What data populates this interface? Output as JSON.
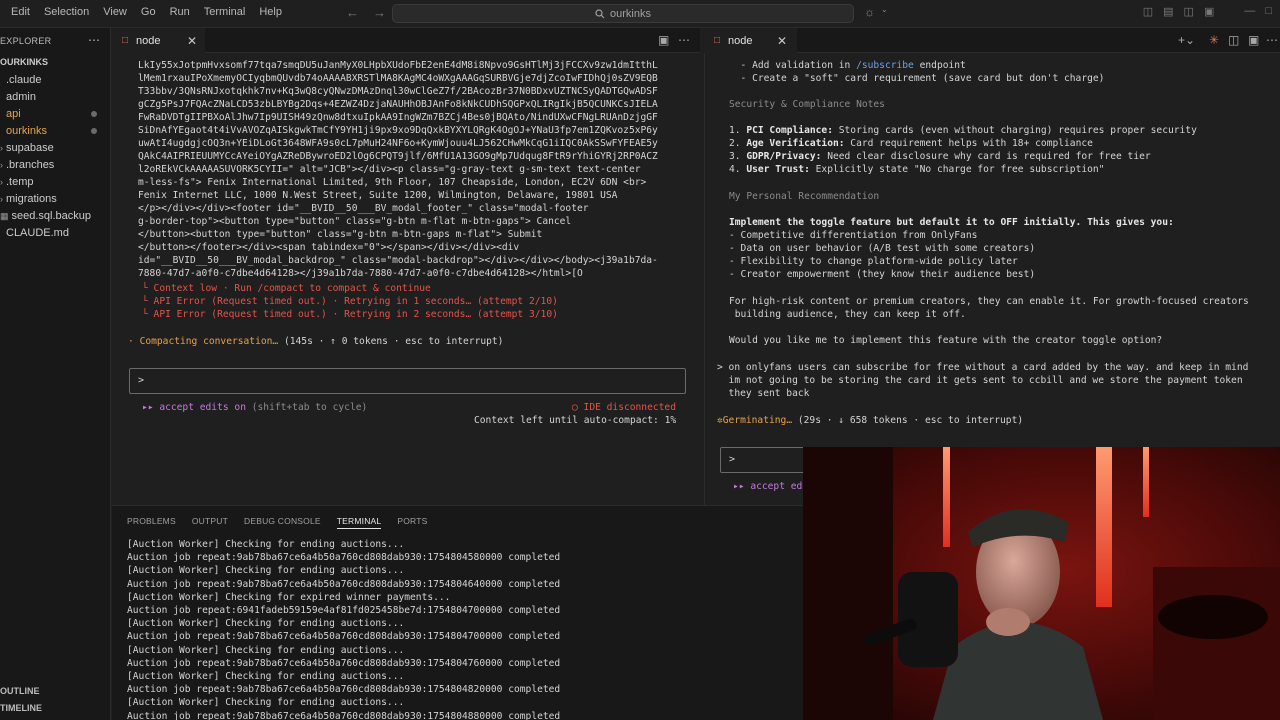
{
  "titlebar": {
    "menus": [
      "Edit",
      "Selection",
      "View",
      "Go",
      "Run",
      "Terminal",
      "Help"
    ],
    "search_text": "ourkinks"
  },
  "explorer": {
    "header": "EXPLORER",
    "project": "OURKINKS",
    "items": [
      {
        "label": ".claude",
        "caret": false
      },
      {
        "label": "admin",
        "caret": false
      },
      {
        "label": "api",
        "caret": false
      },
      {
        "label": "ourkinks",
        "caret": false
      },
      {
        "label": "supabase",
        "caret": true
      },
      {
        "label": ".branches",
        "caret": true
      },
      {
        "label": ".temp",
        "caret": true
      },
      {
        "label": "migrations",
        "caret": true
      },
      {
        "label": "seed.sql.backup",
        "caret": false
      },
      {
        "label": "CLAUDE.md",
        "caret": false
      }
    ],
    "outline": "OUTLINE",
    "timeline": "TIMELINE"
  },
  "left_editor": {
    "tab_label": "node",
    "lines": [
      "LkIy55xJotpmHvxsomf77tqa7smqDU5uJanMyX0LHpbXUdoFbE2enE4dM8i8Npvo9GsHTlMj3jFCCXv9zw1dmItthL",
      "lMem1rxauIPoXmemyOCIyqbmQUvdb74oAAAABXRSTlMA8KAgMC4oWXgAAAGqSURBVGje7djZcoIwFIDhQj0sZV9EQB",
      "T33bbv/3QNsRNJxotqkhk7nv+Kq3wQ8cyQNwzDMAzDnql30wClGeZ7f/2BAcozBr37N0BDxvUZTNCSyQADTGQwADSF",
      "gCZg5PsJ7FQAcZNaLCD53zbLBYBg2Dqs+4EZWZ4DzjaNAUHhOBJAnFo8kNkCUDhSQGPxQLIRgIkjB5QCUNKCsJIELA",
      "FwRaDVDTgIIPBXoAlJhw7Ip9UISH49zQnw8dtxuIpkAA9IngWZm7BZCj4Bes0jBQAto/NindUXwCFNgLRUAnDzjgGF",
      "SiDnAfYEgaot4t4iVvAVOZqAISkgwkTmCfY9YH1ji9px9xo9DqQxkBYXYLQRgK4OgOJ+YNaU3fp7em1ZQKvoz5xP6y",
      "uwAtI4ugdgjcOQ3n+YEiDLoGt3648WFA9s0cL7pMuH24NF6o+KymWjouu4LJ562CHwMkCqG1iIQC0AkSSwFYFEAE5y",
      "QAkC4AIPRIEUUMYCcAYeiOYgAZReDBywroED2lOg6CPQT9jlf/6MfU1A13GO9gMp7Udqug8FtR9rYhiGYRj2RP0ACZ",
      "l2oREkVCkAAAAASUVORK5CYII=\" alt=\"JCB\"></div><p class=\"g-gray-text g-sm-text text-center",
      "m-less-fs\"> Fenix International Limited, 9th Floor, 107 Cheapside, London, EC2V 6DN <br>",
      "Fenix Internet LLC, 1000 N.West Street, Suite 1200, Wilmington, Delaware, 19801 USA",
      "</p></div></div><footer id=\"__BVID__50___BV_modal_footer_\" class=\"modal-footer",
      "g-border-top\"><button type=\"button\" class=\"g-btn m-flat m-btn-gaps\"> Cancel",
      "</button><button type=\"button\" class=\"g-btn m-btn-gaps m-flat\"> Submit",
      "</button></footer></div><span tabindex=\"0\"></span></div></div><div",
      "id=\"__BVID__50___BV_modal_backdrop_\" class=\"modal-backdrop\"></div></div></body><j39a1b7da-",
      "7880-47d7-a0f0-c7dbe4d64128></j39a1b7da-7880-47d7-a0f0-c7dbe4d64128></html>[O"
    ],
    "errors": [
      "└ Context low · Run /compact to compact & continue",
      "└ API Error (Request timed out.) · Retrying in 1 seconds… (attempt 2/10)",
      "└ API Error (Request timed out.) · Retrying in 2 seconds… (attempt 3/10)"
    ],
    "status_symbol": "·",
    "status_main": "Compacting conversation…",
    "status_rest": "(145s · ↑ 0 tokens · esc to interrupt)",
    "prompt_symbol": ">",
    "mode_label": "▸▸ accept edits on",
    "mode_hint": "(shift+tab to cycle)",
    "ide_status": "◯ IDE disconnected",
    "context_left": "Context left until auto-compact: 1%"
  },
  "right_editor": {
    "tab_label": "node",
    "top_lines": [
      "  - Add validation in /subscribe endpoint",
      "  - Create a \"soft\" card requirement (save card but don't charge)"
    ],
    "section_security": "Security & Compliance Notes",
    "compliance": [
      {
        "n": "1. ",
        "label": "PCI Compliance:",
        "text": " Storing cards (even without charging) requires proper security"
      },
      {
        "n": "2. ",
        "label": "Age Verification:",
        "text": " Card requirement helps with 18+ compliance"
      },
      {
        "n": "3. ",
        "label": "GDPR/Privacy:",
        "text": " Need clear disclosure why card is required for free tier"
      },
      {
        "n": "4. ",
        "label": "User Trust:",
        "text": " Explicitly state \"No charge for free subscription\""
      }
    ],
    "section_recommendation": "My Personal Recommendation",
    "recommendation": "Implement the toggle feature but default it to OFF initially. This gives you:",
    "benefits": [
      "- Competitive differentiation from OnlyFans",
      "- Data on user behavior (A/B test with some creators)",
      "- Flexibility to change platform-wide policy later",
      "- Creator empowerment (they know their audience best)"
    ],
    "para_1": "For high-risk content or premium creators, they can enable it. For growth-focused creators",
    "para_2": " building audience, they can keep it off.",
    "question": "Would you like me to implement this feature with the creator toggle option?",
    "user_msg": [
      "> on onlyfans users can subscribe for free without a card added by the way. and keep in mind",
      "  im not going to be storing the card it gets sent to ccbill and we store the payment token",
      "  they sent back"
    ],
    "status_symbol": "✲",
    "status_main": "Germinating…",
    "status_rest": "(29s · ↓ 658 tokens · esc to interrupt)",
    "prompt_symbol": ">",
    "mode_label": "▸▸ accept edi"
  },
  "panel": {
    "tabs": [
      "PROBLEMS",
      "OUTPUT",
      "DEBUG CONSOLE",
      "TERMINAL",
      "PORTS"
    ],
    "active_tab": "TERMINAL",
    "lines": [
      "[Auction Worker] Checking for ending auctions...",
      "Auction job repeat:9ab78ba67ce6a4b50a760cd808dab930:1754804580000 completed",
      "[Auction Worker] Checking for ending auctions...",
      "Auction job repeat:9ab78ba67ce6a4b50a760cd808dab930:1754804640000 completed",
      "[Auction Worker] Checking for expired winner payments...",
      "Auction job repeat:6941fadeb59159e4af81fd025458be7d:1754804700000 completed",
      "[Auction Worker] Checking for ending auctions...",
      "Auction job repeat:9ab78ba67ce6a4b50a760cd808dab930:1754804700000 completed",
      "[Auction Worker] Checking for ending auctions...",
      "Auction job repeat:9ab78ba67ce6a4b50a760cd808dab930:1754804760000 completed",
      "[Auction Worker] Checking for ending auctions...",
      "Auction job repeat:9ab78ba67ce6a4b50a760cd808dab930:1754804820000 completed",
      "[Auction Worker] Checking for ending auctions...",
      "Auction job repeat:9ab78ba67ce6a4b50a760cd808dab930:1754804880000 completed"
    ]
  },
  "colors": {
    "error": "#e5534b",
    "accent_magenta": "#c678dd",
    "status_orange": "#e8a24a",
    "tab_icon": "#e76b5b"
  },
  "icons": [
    "search-icon",
    "nav-back-icon",
    "nav-forward-icon",
    "copilot-icon",
    "lock-icon",
    "more-icon",
    "close-icon",
    "add-icon",
    "split-icon",
    "layout-icon",
    "minimize-icon",
    "maximize-icon"
  ]
}
